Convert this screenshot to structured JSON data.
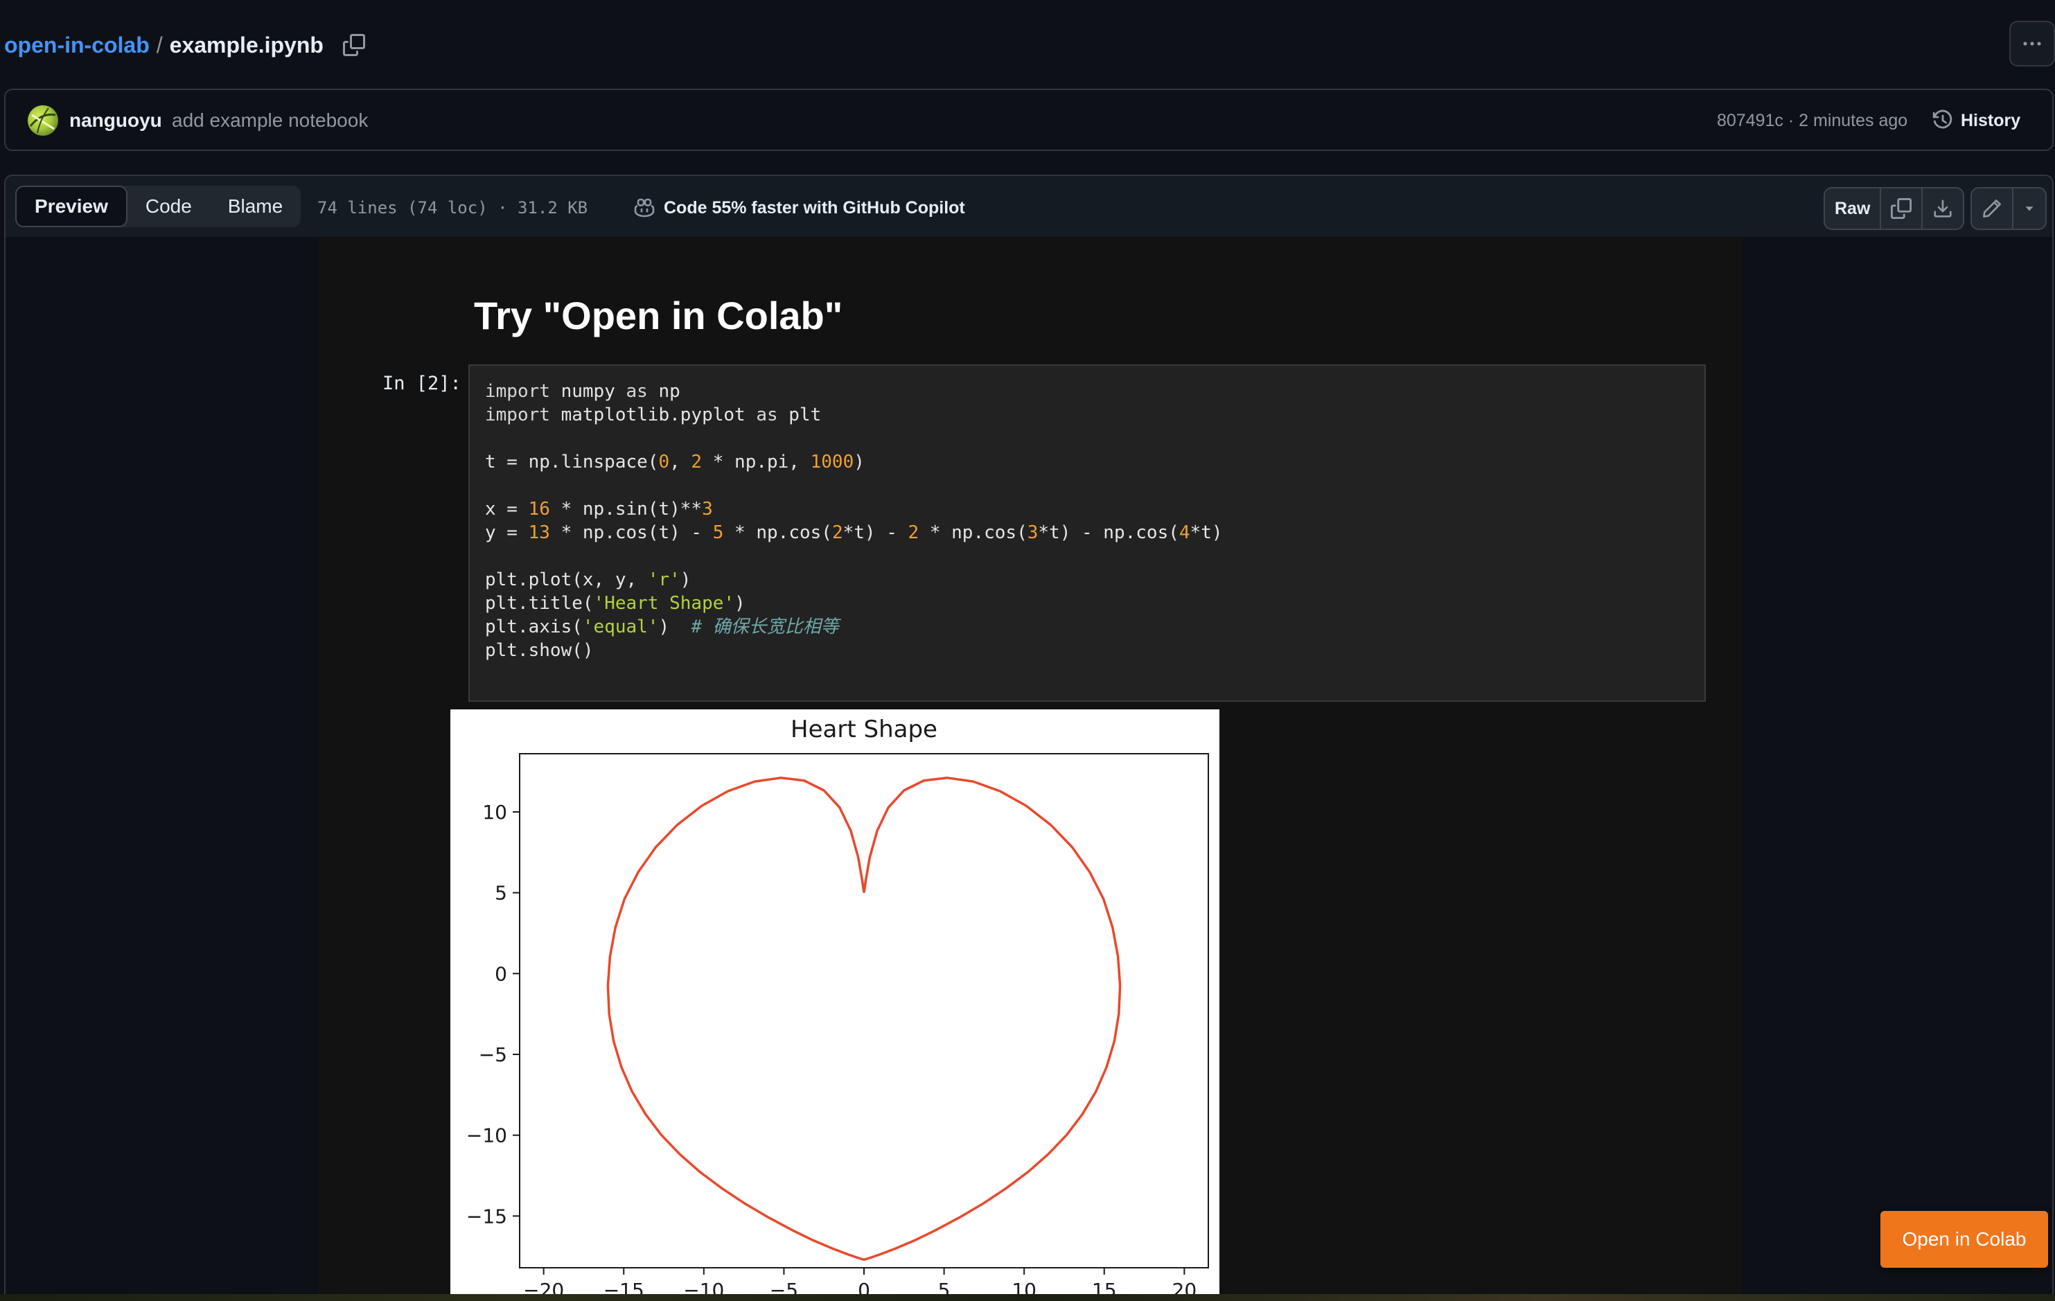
{
  "breadcrumb": {
    "repo": "open-in-colab",
    "separator": "/",
    "file": "example.ipynb"
  },
  "commit": {
    "author": "nanguoyu",
    "message": "add example notebook",
    "meta": "807491c · 2 minutes ago",
    "history_label": "History"
  },
  "file_header": {
    "tabs": [
      "Preview",
      "Code",
      "Blame"
    ],
    "active_tab": "Preview",
    "stats": "74 lines (74 loc) · 31.2 KB",
    "copilot": "Code 55% faster with GitHub Copilot",
    "raw_label": "Raw"
  },
  "notebook": {
    "heading": "Try \"Open in Colab\"",
    "prompt": "In [2]:",
    "code_lines": [
      [
        [
          "kw",
          "import"
        ],
        [
          "t",
          " numpy "
        ],
        [
          "kw",
          "as"
        ],
        [
          "t",
          " np"
        ]
      ],
      [
        [
          "kw",
          "import"
        ],
        [
          "t",
          " matplotlib.pyplot "
        ],
        [
          "kw",
          "as"
        ],
        [
          "t",
          " plt"
        ]
      ],
      [],
      [
        [
          "t",
          "t = np.linspace("
        ],
        [
          "num",
          "0"
        ],
        [
          "t",
          ", "
        ],
        [
          "num",
          "2"
        ],
        [
          "t",
          " * np.pi, "
        ],
        [
          "num",
          "1000"
        ],
        [
          "t",
          ")"
        ]
      ],
      [],
      [
        [
          "t",
          "x = "
        ],
        [
          "num",
          "16"
        ],
        [
          "t",
          " * np.sin(t)**"
        ],
        [
          "num",
          "3"
        ]
      ],
      [
        [
          "t",
          "y = "
        ],
        [
          "num",
          "13"
        ],
        [
          "t",
          " * np.cos(t) - "
        ],
        [
          "num",
          "5"
        ],
        [
          "t",
          " * np.cos("
        ],
        [
          "num",
          "2"
        ],
        [
          "t",
          "*t) - "
        ],
        [
          "num",
          "2"
        ],
        [
          "t",
          " * np.cos("
        ],
        [
          "num",
          "3"
        ],
        [
          "t",
          "*t) - np.cos("
        ],
        [
          "num",
          "4"
        ],
        [
          "t",
          "*t)"
        ]
      ],
      [],
      [
        [
          "t",
          "plt.plot(x, y, "
        ],
        [
          "str",
          "'r'"
        ],
        [
          "t",
          ")"
        ]
      ],
      [
        [
          "t",
          "plt.title("
        ],
        [
          "str",
          "'Heart Shape'"
        ],
        [
          "t",
          ")"
        ]
      ],
      [
        [
          "t",
          "plt.axis("
        ],
        [
          "str",
          "'equal'"
        ],
        [
          "t",
          ")  "
        ],
        [
          "cm",
          "# 确保长宽比相等"
        ]
      ],
      [
        [
          "t",
          "plt.show()"
        ]
      ]
    ]
  },
  "chart_data": {
    "type": "line",
    "title": "Heart Shape",
    "xlabel": "",
    "ylabel": "",
    "xlim": [
      -21.5,
      21.5
    ],
    "ylim": [
      -18.2,
      13.6
    ],
    "xticks": [
      -20,
      -15,
      -10,
      -5,
      0,
      5,
      10,
      15,
      20
    ],
    "yticks": [
      -15,
      -10,
      -5,
      0,
      5,
      10
    ],
    "xtick_labels": [
      "−20",
      "−15",
      "−10",
      "−5",
      "0",
      "5",
      "10",
      "15",
      "20"
    ],
    "ytick_labels": [
      "−15",
      "−10",
      "−5",
      "0",
      "5",
      "10"
    ],
    "series": [
      {
        "color": "#e8492c",
        "x": [
          0.0,
          0.01,
          0.11,
          0.36,
          0.82,
          1.52,
          2.5,
          3.74,
          5.2,
          6.82,
          8.5,
          10.14,
          11.66,
          13.0,
          14.1,
          14.96,
          15.52,
          15.86,
          15.99,
          15.91,
          15.63,
          15.14,
          14.48,
          13.64,
          12.65,
          11.5,
          10.23,
          8.85,
          7.41,
          5.94,
          4.49,
          3.14,
          1.94,
          0.98,
          0.34,
          0.04,
          0.0,
          -0.04,
          -0.34,
          -0.98,
          -1.94,
          -3.14,
          -4.49,
          -5.94,
          -7.41,
          -8.85,
          -10.23,
          -11.5,
          -12.65,
          -13.64,
          -14.48,
          -15.14,
          -15.63,
          -15.91,
          -15.99,
          -15.86,
          -15.52,
          -14.96,
          -14.1,
          -13.0,
          -11.66,
          -10.14,
          -8.5,
          -6.82,
          -5.2,
          -3.74,
          -2.5,
          -1.52,
          -0.82,
          -0.36,
          -0.11,
          -0.01,
          0.0
        ],
        "y": [
          5.0,
          5.06,
          5.74,
          7.19,
          8.83,
          10.27,
          11.33,
          11.94,
          12.11,
          11.88,
          11.28,
          10.37,
          9.2,
          7.82,
          6.27,
          4.6,
          2.85,
          1.06,
          -0.74,
          -2.5,
          -4.19,
          -5.8,
          -7.3,
          -8.7,
          -9.99,
          -11.18,
          -12.28,
          -13.3,
          -14.25,
          -15.1,
          -15.87,
          -16.52,
          -17.02,
          -17.38,
          -17.6,
          -17.69,
          -17.7,
          -17.69,
          -17.6,
          -17.38,
          -17.02,
          -16.52,
          -15.87,
          -15.1,
          -14.25,
          -13.3,
          -12.28,
          -11.18,
          -9.99,
          -8.7,
          -7.3,
          -5.8,
          -4.19,
          -2.5,
          -0.74,
          1.06,
          2.85,
          4.6,
          6.27,
          7.82,
          9.2,
          10.37,
          11.28,
          11.88,
          12.11,
          11.94,
          11.33,
          10.27,
          8.83,
          7.19,
          5.74,
          5.06,
          5.0
        ]
      }
    ],
    "grid": false
  },
  "open_colab_label": "Open in Colab",
  "icons": {
    "copy": "copy-icon",
    "more": "kebab-horizontal-icon",
    "history": "history-clock-icon",
    "copilot": "copilot-icon",
    "download": "download-icon",
    "pencil": "pencil-icon",
    "caret": "triangle-down-icon"
  }
}
